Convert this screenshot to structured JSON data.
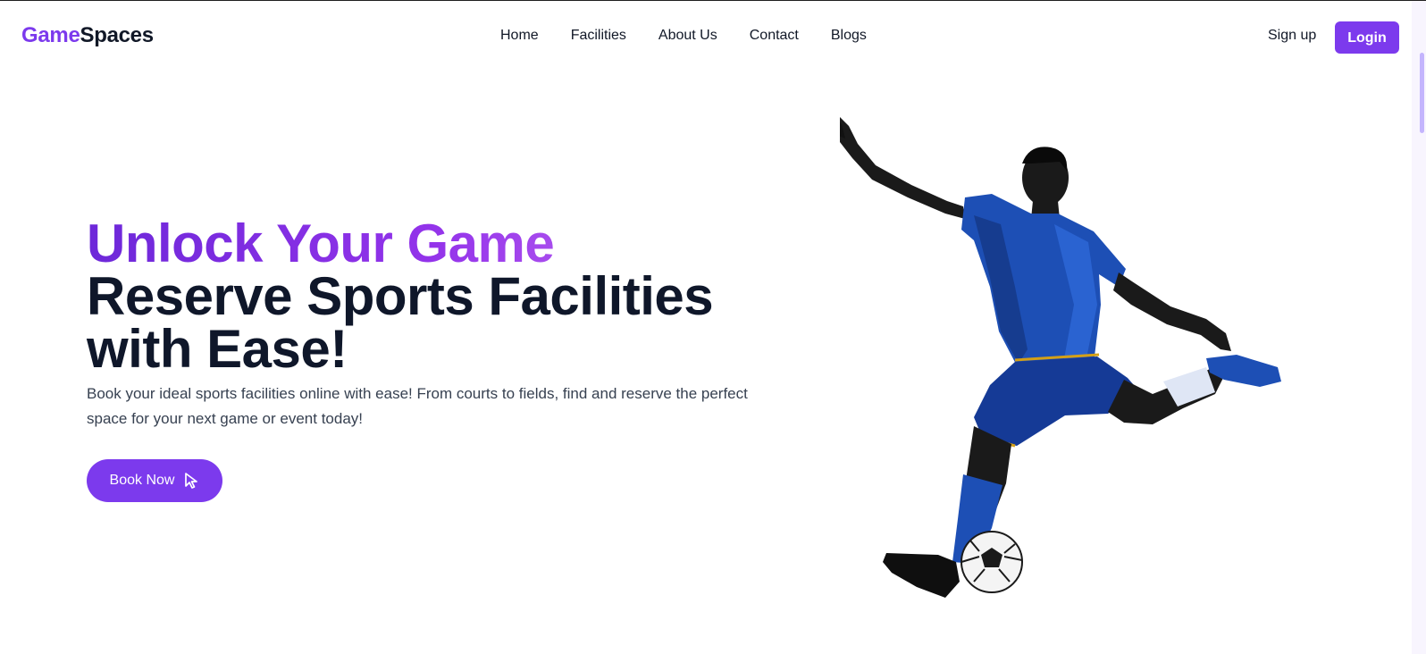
{
  "header": {
    "logo_part1": "Game",
    "logo_part2": "Spaces",
    "nav": [
      "Home",
      "Facilities",
      "About Us",
      "Contact",
      "Blogs"
    ],
    "signup_label": "Sign up",
    "login_label": "Login"
  },
  "hero": {
    "title_accent": "Unlock Your Game",
    "title_line1": "Reserve Sports Facilities",
    "title_line2": "with Ease!",
    "description": "Book your ideal sports facilities online with ease! From courts to fields, find and reserve the perfect space for your next game or event today!",
    "cta_label": "Book Now",
    "cta_icon": "cursor-icon",
    "illustration": "soccer-player-kicking-ball"
  },
  "colors": {
    "brand": "#7c3aed",
    "accent_gradient_end": "#c26bf2",
    "heading": "#0f172a",
    "body_text": "#374151",
    "jersey_blue": "#1d4fb5"
  }
}
